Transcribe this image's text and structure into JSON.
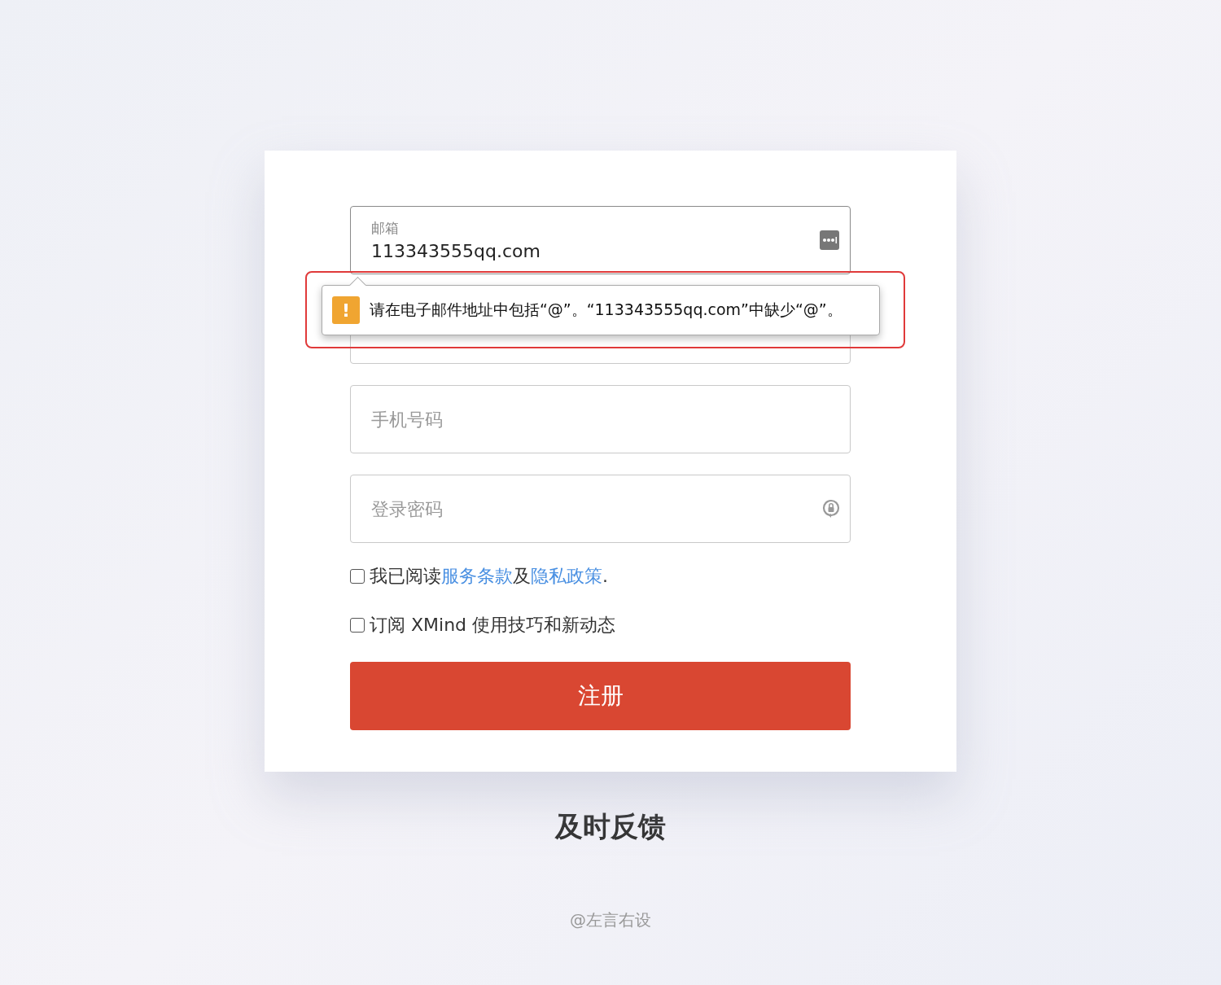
{
  "form": {
    "fields": [
      {
        "kind": "email",
        "label": "邮箱",
        "value": "113343555qq.com"
      },
      {
        "kind": "covered"
      },
      {
        "kind": "text",
        "placeholder": "手机号码"
      },
      {
        "kind": "password",
        "placeholder": "登录密码"
      }
    ],
    "tooltip": {
      "icon": "!",
      "message": "请在电子邮件地址中包括“@”。“113343555qq.com”中缺少“@”。",
      "highlighted": true
    },
    "checkboxes": [
      {
        "checked": false,
        "parts": [
          {
            "kind": "text",
            "text": "我已阅读"
          },
          {
            "kind": "link",
            "text": "服务条款"
          },
          {
            "kind": "text",
            "text": "及"
          },
          {
            "kind": "link",
            "text": "隐私政策"
          },
          {
            "kind": "text",
            "text": "."
          }
        ]
      },
      {
        "checked": false,
        "parts": [
          {
            "kind": "text",
            "text": "订阅 XMind 使用技巧和新动态"
          }
        ]
      }
    ],
    "submit": "注册"
  },
  "caption": "及时反馈",
  "credit": "@左言右设"
}
